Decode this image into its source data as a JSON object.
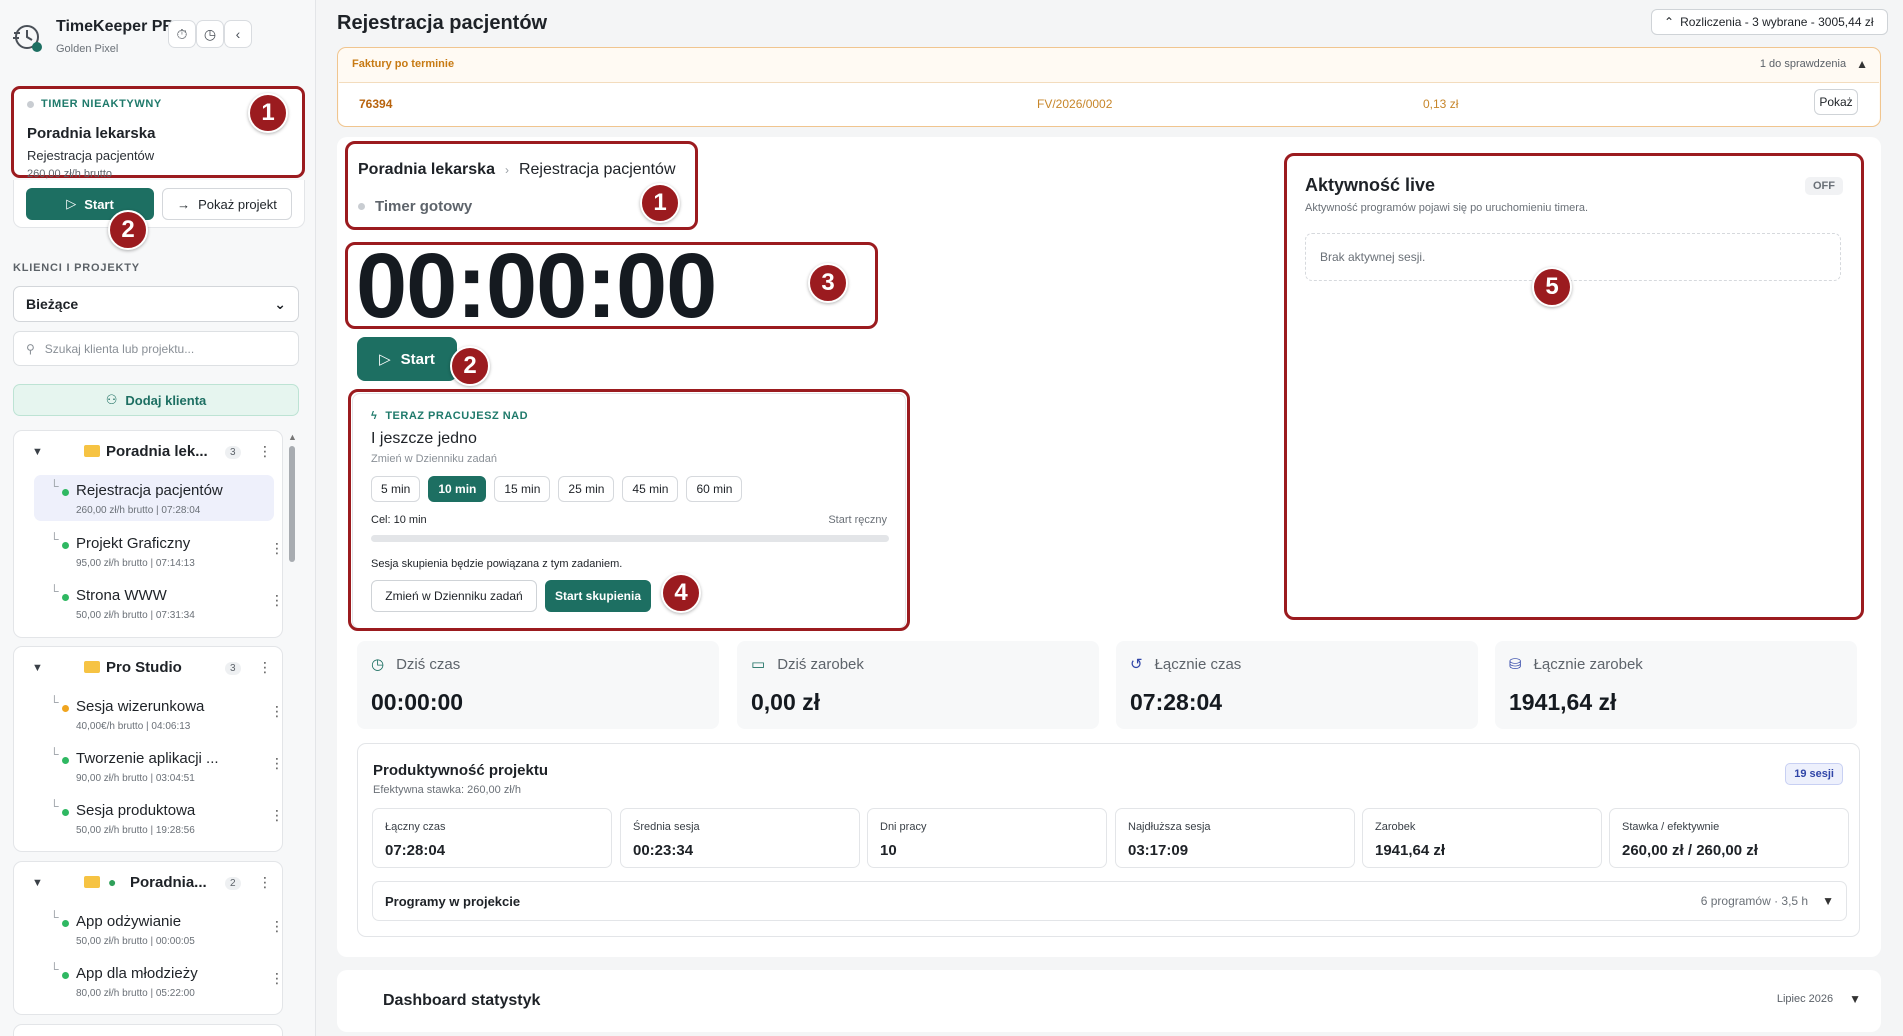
{
  "app": {
    "title": "TimeKeeper PRO",
    "subtitle": "Golden Pixel",
    "accent": "#1d6f62",
    "highlight": "#9b1b1f"
  },
  "sidebar": {
    "timer_card": {
      "status": "TIMER NIEAKTYWNY",
      "client": "Poradnia lekarska",
      "project": "Rejestracja pacjentów",
      "rate": "260,00 zł/h brutto"
    },
    "start_label": "Start",
    "show_project_label": "Pokaż projekt",
    "section_label": "KLIENCI I PROJEKTY",
    "filter_value": "Bieżące",
    "search_placeholder": "Szukaj klienta lub projektu...",
    "add_client_label": "Dodaj klienta",
    "groups": [
      {
        "name": "Poradnia lek...",
        "count": "3",
        "projects": [
          {
            "name": "Rejestracja pacjentów",
            "meta": "260,00 zł/h brutto | 07:28:04",
            "dot": "green"
          },
          {
            "name": "Projekt Graficzny",
            "meta": "95,00 zł/h brutto | 07:14:13",
            "dot": "green"
          },
          {
            "name": "Strona WWW",
            "meta": "50,00 zł/h brutto | 07:31:34",
            "dot": "green"
          }
        ]
      },
      {
        "name": "Pro Studio",
        "count": "3",
        "projects": [
          {
            "name": "Sesja wizerunkowa",
            "meta": "40,00€/h brutto | 04:06:13",
            "dot": "orange"
          },
          {
            "name": "Tworzenie aplikacji ...",
            "meta": "90,00 zł/h brutto | 03:04:51",
            "dot": "green"
          },
          {
            "name": "Sesja produktowa",
            "meta": "50,00 zł/h brutto | 19:28:56",
            "dot": "green"
          }
        ]
      },
      {
        "name": "Poradnia...",
        "count": "2",
        "projects": [
          {
            "name": "App odżywianie",
            "meta": "50,00 zł/h brutto | 00:00:05",
            "dot": "green"
          },
          {
            "name": "App dla młodzieży",
            "meta": "80,00 zł/h brutto | 05:22:00",
            "dot": "green"
          }
        ]
      }
    ]
  },
  "header": {
    "title": "Rejestracja pacjentów",
    "billing": "Rozliczenia - 3 wybrane - 3005,44 zł"
  },
  "overdue": {
    "title": "Faktury po terminie",
    "review": "1 do sprawdzenia",
    "number": "76394",
    "invoice": "FV/2026/0002",
    "amount": "0,13 zł",
    "show_label": "Pokaż"
  },
  "timer": {
    "client": "Poradnia lekarska",
    "project": "Rejestracja pacjentów",
    "status": "Timer gotowy",
    "clock": "00:00:00",
    "start_label": "Start"
  },
  "focus": {
    "label": "TERAZ PRACUJESZ NAD",
    "task": "I jeszcze jedno",
    "change_hint": "Zmień w Dzienniku zadań",
    "chips": [
      "5 min",
      "10 min",
      "15 min",
      "25 min",
      "45 min",
      "60 min"
    ],
    "goal": "Cel: 10 min",
    "mode": "Start ręczny",
    "progress": 0,
    "note": "Sesja skupienia będzie powiązana z tym zadaniem.",
    "change_button": "Zmień w Dzienniku zadań",
    "start_button": "Start skupienia"
  },
  "live": {
    "title": "Aktywność live",
    "status": "OFF",
    "subtitle": "Aktywność programów pojawi się po uruchomieniu timera.",
    "empty": "Brak aktywnej sesji."
  },
  "stats": [
    {
      "label": "Dziś czas",
      "value": "00:00:00"
    },
    {
      "label": "Dziś zarobek",
      "value": "0,00 zł"
    },
    {
      "label": "Łącznie czas",
      "value": "07:28:04"
    },
    {
      "label": "Łącznie zarobek",
      "value": "1941,64 zł"
    }
  ],
  "productivity": {
    "title": "Produktywność projektu",
    "subtitle": "Efektywna stawka: 260,00 zł/h",
    "sessions": "19 sesji",
    "metrics": [
      {
        "label": "Łączny czas",
        "value": "07:28:04"
      },
      {
        "label": "Średnia sesja",
        "value": "00:23:34"
      },
      {
        "label": "Dni pracy",
        "value": "10"
      },
      {
        "label": "Najdłuższa sesja",
        "value": "03:17:09"
      },
      {
        "label": "Zarobek",
        "value": "1941,64 zł"
      },
      {
        "label": "Stawka / efektywnie",
        "value": "260,00 zł / 260,00 zł"
      }
    ],
    "programs_label": "Programy w projekcie",
    "programs_summary": "6 programów · 3,5 h"
  },
  "dashboard": {
    "title": "Dashboard statystyk",
    "period": "Lipiec 2026"
  },
  "badges": [
    "1",
    "2",
    "1",
    "3",
    "2",
    "4",
    "5"
  ]
}
